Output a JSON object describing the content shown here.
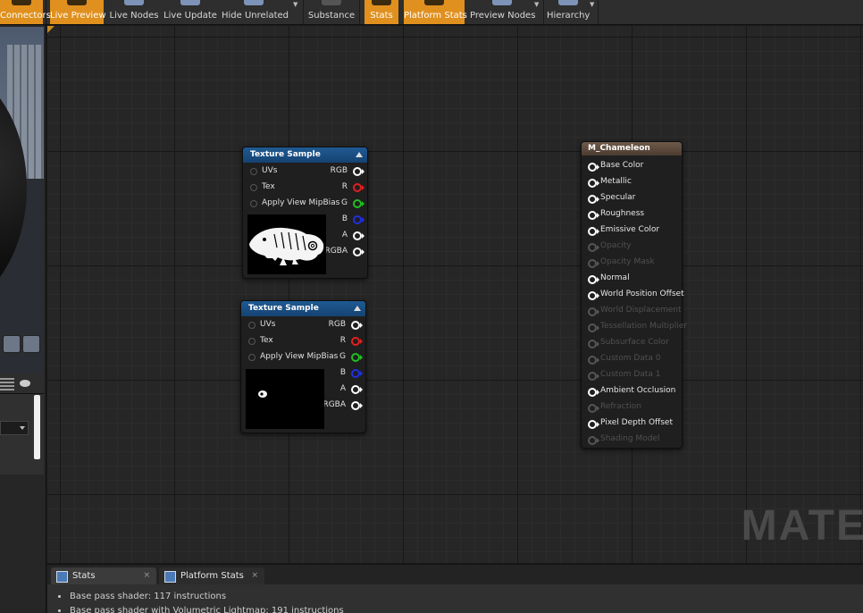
{
  "toolbar": {
    "buttons": [
      {
        "label": "Connectors",
        "active": true
      },
      {
        "label": "Live Preview",
        "active": true
      },
      {
        "label": "Live Nodes",
        "active": false
      },
      {
        "label": "Live Update",
        "active": false
      },
      {
        "label": "Hide Unrelated",
        "active": false
      },
      {
        "label": "Substance",
        "active": false
      },
      {
        "label": "Stats",
        "active": true
      },
      {
        "label": "Platform Stats",
        "active": true
      },
      {
        "label": "Preview Nodes",
        "active": false
      },
      {
        "label": "Hierarchy",
        "active": false
      }
    ]
  },
  "graph": {
    "watermark": "MATE",
    "texture_nodes": [
      {
        "title": "Texture Sample",
        "inputs": [
          "UVs",
          "Tex",
          "Apply View MipBias"
        ],
        "outputs": [
          "RGB",
          "R",
          "G",
          "B",
          "A",
          "RGBA"
        ],
        "preview": "chameleon silhouette"
      },
      {
        "title": "Texture Sample",
        "inputs": [
          "UVs",
          "Tex",
          "Apply View MipBias"
        ],
        "outputs": [
          "RGB",
          "R",
          "G",
          "B",
          "A",
          "RGBA"
        ],
        "preview": "eye dot"
      }
    ],
    "output_colors": {
      "RGB": "#ffffff",
      "R": "#e02020",
      "G": "#20c020",
      "B": "#2030e0",
      "A": "#ffffff",
      "RGBA": "#ffffff"
    },
    "material_node": {
      "title": "M_Chameleon",
      "pins": [
        {
          "label": "Base Color",
          "enabled": true
        },
        {
          "label": "Metallic",
          "enabled": true
        },
        {
          "label": "Specular",
          "enabled": true
        },
        {
          "label": "Roughness",
          "enabled": true
        },
        {
          "label": "Emissive Color",
          "enabled": true
        },
        {
          "label": "Opacity",
          "enabled": false
        },
        {
          "label": "Opacity Mask",
          "enabled": false
        },
        {
          "label": "Normal",
          "enabled": true
        },
        {
          "label": "World Position Offset",
          "enabled": true
        },
        {
          "label": "World Displacement",
          "enabled": false
        },
        {
          "label": "Tessellation Multiplier",
          "enabled": false
        },
        {
          "label": "Subsurface Color",
          "enabled": false
        },
        {
          "label": "Custom Data 0",
          "enabled": false
        },
        {
          "label": "Custom Data 1",
          "enabled": false
        },
        {
          "label": "Ambient Occlusion",
          "enabled": true
        },
        {
          "label": "Refraction",
          "enabled": false
        },
        {
          "label": "Pixel Depth Offset",
          "enabled": true
        },
        {
          "label": "Shading Model",
          "enabled": false
        }
      ]
    }
  },
  "stats_panel": {
    "tabs": [
      {
        "label": "Stats",
        "close": "×"
      },
      {
        "label": "Platform Stats",
        "close": "×"
      }
    ],
    "lines": [
      "Base pass shader: 117 instructions",
      "Base pass shader with Volumetric Lightmap: 191 instructions"
    ]
  }
}
